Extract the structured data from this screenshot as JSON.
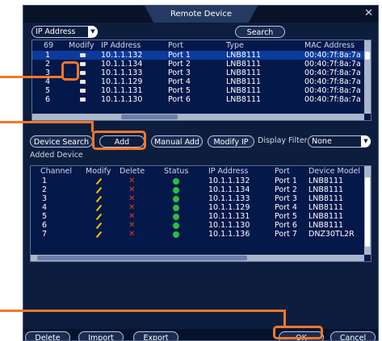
{
  "dialog": {
    "title": "Remote Device",
    "close_icon": "close-icon"
  },
  "search": {
    "filter_value": "IP Address",
    "search_button": "Search",
    "count": "69",
    "columns": [
      "Modify",
      "IP Address",
      "Port",
      "Type",
      "MAC Address"
    ],
    "rows": [
      {
        "no": "1",
        "ip": "10.1.1.132",
        "port": "Port 1",
        "type": "LNB8111",
        "mac": "00:40:7f:8a:7a"
      },
      {
        "no": "2",
        "ip": "10.1.1.134",
        "port": "Port 2",
        "type": "LNB8111",
        "mac": "00:40:7f:8a:7a"
      },
      {
        "no": "3",
        "ip": "10.1.1.133",
        "port": "Port 3",
        "type": "LNB8111",
        "mac": "00:40:7f:8a:7a"
      },
      {
        "no": "4",
        "ip": "10.1.1.129",
        "port": "Port 4",
        "type": "LNB8111",
        "mac": "00:40:7f:8a:7a"
      },
      {
        "no": "5",
        "ip": "10.1.1.131",
        "port": "Port 5",
        "type": "LNB8111",
        "mac": "00:40:7f:8a:7a"
      },
      {
        "no": "6",
        "ip": "10.1.1.130",
        "port": "Port 6",
        "type": "LNB8111",
        "mac": "00:40:7f:8a:7a"
      }
    ]
  },
  "actions": {
    "device_search": "Device Search",
    "add": "Add",
    "manual_add": "Manual Add",
    "modify_ip": "Modify IP",
    "display_filter_label": "Display Filter",
    "display_filter_value": "None"
  },
  "added": {
    "section_label": "Added Device",
    "columns": [
      "Channel",
      "Modify",
      "Delete",
      "Status",
      "IP Address",
      "Port",
      "Device Model"
    ],
    "rows": [
      {
        "ch": "1",
        "ip": "10.1.1.132",
        "port": "Port 1",
        "model": "LNB8111"
      },
      {
        "ch": "2",
        "ip": "10.1.1.134",
        "port": "Port 2",
        "model": "LNB8111"
      },
      {
        "ch": "3",
        "ip": "10.1.1.133",
        "port": "Port 3",
        "model": "LNB8111"
      },
      {
        "ch": "4",
        "ip": "10.1.1.129",
        "port": "Port 4",
        "model": "LNB8111"
      },
      {
        "ch": "5",
        "ip": "10.1.1.131",
        "port": "Port 5",
        "model": "LNB8111"
      },
      {
        "ch": "6",
        "ip": "10.1.1.130",
        "port": "Port 6",
        "model": "LNB8111"
      },
      {
        "ch": "7",
        "ip": "10.1.1.136",
        "port": "Port 7",
        "model": "DNZ30TL2R"
      }
    ]
  },
  "footer": {
    "delete": "Delete",
    "import": "Import",
    "export": "Export",
    "ok": "OK",
    "cancel": "Cancel"
  },
  "colors": {
    "accent_callout": "#f0782a",
    "status_online": "#27c13c",
    "delete_mark": "#e03a1a",
    "modify_pencil": "#f2c400"
  }
}
